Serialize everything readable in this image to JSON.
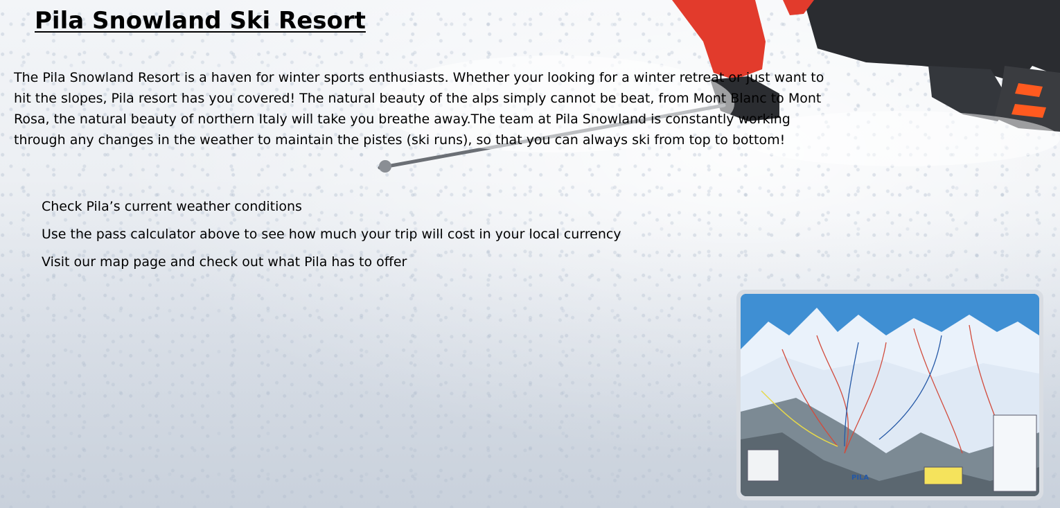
{
  "page": {
    "title": "Pila Snowland Ski Resort",
    "intro": "The Pila Snowland Resort is a haven for winter sports enthusiasts. Whether your looking for a winter retreat or just want to hit the slopes, Pila resort has you covered! The natural beauty of the alps simply cannot be beat, from Mont Blanc to Mont Rosa, the natural beauty of northern Italy will take you breathe away.The team at Pila Snowland is constantly working through any changes in the weather to maintain the pistes (ski runs), so that you can always ski from top to bottom!",
    "links": [
      "Check Pila’s current weather conditions",
      "Use the pass calculator above to see how much your trip will cost in your local currency",
      "Visit our map page and check out what Pila has to offer"
    ]
  },
  "map_image": {
    "label": "PILA",
    "icon": "ski-map-image"
  },
  "colors": {
    "jacket": "#e23b2c",
    "pants": "#2a2c30",
    "boot_accent": "#ff5a1f",
    "map_sky": "#3f8fd3"
  }
}
